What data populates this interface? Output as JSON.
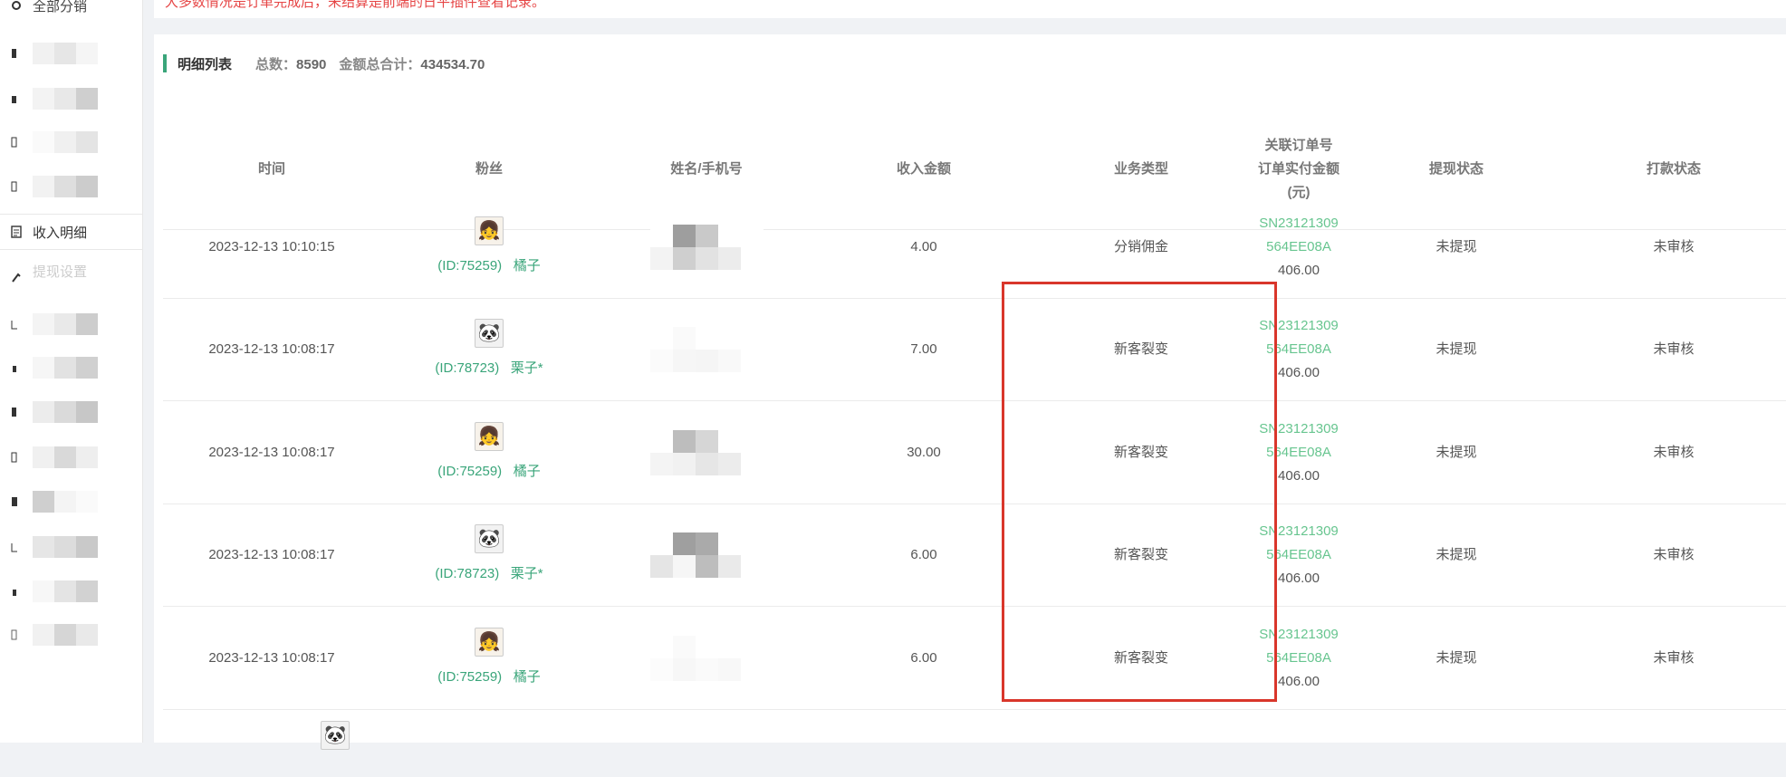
{
  "sidebar": {
    "items": [
      {
        "label": "全部分销",
        "active": false
      },
      {
        "label": "",
        "active": false
      },
      {
        "label": "",
        "active": false
      },
      {
        "label": "",
        "active": false
      },
      {
        "label": "",
        "active": false
      },
      {
        "label": "收入明细",
        "active": true
      },
      {
        "label": "提现设置",
        "active": false
      }
    ]
  },
  "top_notice": "大多数情况是订单完成后，未结算是前端的日平插件查看记录。",
  "panel": {
    "title": "明细列表",
    "total_label": "总数：",
    "total_value": "8590",
    "sum_label": "金额总合计：",
    "sum_value": "434534.70"
  },
  "table": {
    "headers": {
      "time": "时间",
      "fan": "粉丝",
      "name_phone": "姓名/手机号",
      "income": "收入金额",
      "biz_type": "业务类型",
      "order_no": "关联订单号",
      "order_paid": "订单实付金额",
      "order_paid_unit": "(元)",
      "withdraw_status": "提现状态",
      "pay_status": "打款状态"
    },
    "rows": [
      {
        "time": "2023-12-13 10:10:15",
        "fan_id": "(ID:75259)",
        "fan_name": "橘子",
        "income": "4.00",
        "biz_type": "分销佣金",
        "order_no_1": "SN23121309",
        "order_no_2": "564EE08A",
        "order_paid": "406.00",
        "withdraw_status": "未提现",
        "pay_status": "未审核"
      },
      {
        "time": "2023-12-13 10:08:17",
        "fan_id": "(ID:78723)",
        "fan_name": "栗子*",
        "income": "7.00",
        "biz_type": "新客裂变",
        "order_no_1": "SN23121309",
        "order_no_2": "564EE08A",
        "order_paid": "406.00",
        "withdraw_status": "未提现",
        "pay_status": "未审核"
      },
      {
        "time": "2023-12-13 10:08:17",
        "fan_id": "(ID:75259)",
        "fan_name": "橘子",
        "income": "30.00",
        "biz_type": "新客裂变",
        "order_no_1": "SN23121309",
        "order_no_2": "564EE08A",
        "order_paid": "406.00",
        "withdraw_status": "未提现",
        "pay_status": "未审核"
      },
      {
        "time": "2023-12-13 10:08:17",
        "fan_id": "(ID:78723)",
        "fan_name": "栗子*",
        "income": "6.00",
        "biz_type": "新客裂变",
        "order_no_1": "SN23121309",
        "order_no_2": "564EE08A",
        "order_paid": "406.00",
        "withdraw_status": "未提现",
        "pay_status": "未审核"
      },
      {
        "time": "2023-12-13 10:08:17",
        "fan_id": "(ID:75259)",
        "fan_name": "橘子",
        "income": "6.00",
        "biz_type": "新客裂变",
        "order_no_1": "SN23121309",
        "order_no_2": "564EE08A",
        "order_paid": "406.00",
        "withdraw_status": "未提现",
        "pay_status": "未审核"
      }
    ]
  },
  "colors": {
    "accent": "#3aa57a",
    "link": "#67c58f",
    "highlight_box": "#d9362b",
    "warning": "#e64545"
  },
  "icons": {
    "sidebar_receipt": "document-icon"
  }
}
